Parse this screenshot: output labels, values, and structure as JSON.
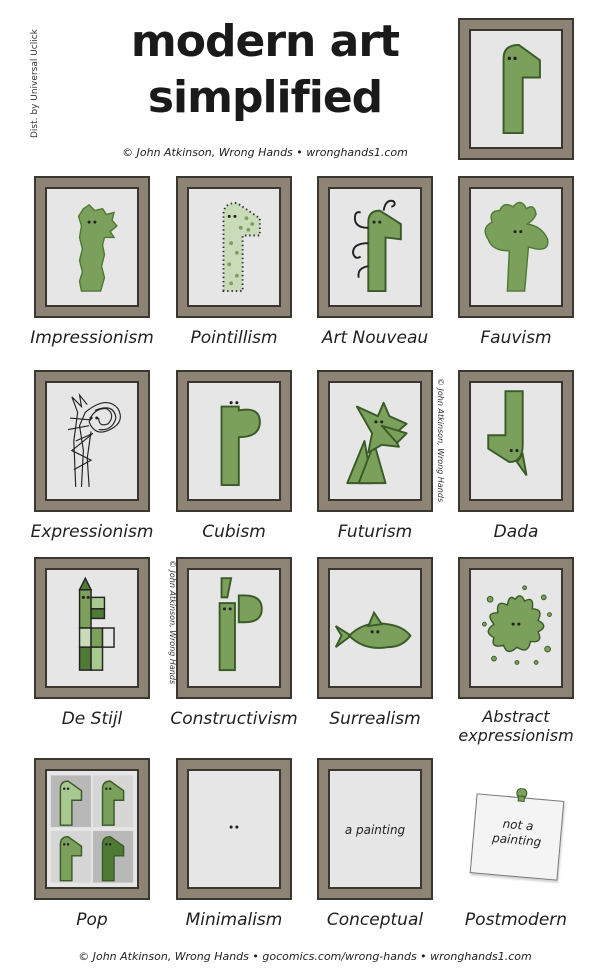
{
  "header": {
    "dist": "Dist. by Universal Uclick",
    "title_line1": "modern art",
    "title_line2": "simplified",
    "credit": "© John Atkinson, Wrong Hands • wronghands1.com"
  },
  "side_credits": {
    "upper": "© John Atkinson, Wrong Hands",
    "lower": "© John Atkinson, Wrong Hands"
  },
  "paintings": [
    {
      "id": "impressionism",
      "label": "Impressionism"
    },
    {
      "id": "pointillism",
      "label": "Pointillism"
    },
    {
      "id": "art-nouveau",
      "label": "Art Nouveau"
    },
    {
      "id": "fauvism",
      "label": "Fauvism"
    },
    {
      "id": "expressionism",
      "label": "Expressionism"
    },
    {
      "id": "cubism",
      "label": "Cubism"
    },
    {
      "id": "futurism",
      "label": "Futurism"
    },
    {
      "id": "dada",
      "label": "Dada"
    },
    {
      "id": "de-stijl",
      "label": "De Stijl"
    },
    {
      "id": "constructivism",
      "label": "Constructivism"
    },
    {
      "id": "surrealism",
      "label": "Surrealism"
    },
    {
      "id": "abstract-expressionism",
      "label_line1": "Abstract",
      "label_line2": "expressionism"
    },
    {
      "id": "pop",
      "label": "Pop"
    },
    {
      "id": "minimalism",
      "label": "Minimalism"
    },
    {
      "id": "conceptual",
      "label": "Conceptual",
      "canvas_text": "a painting"
    },
    {
      "id": "postmodern",
      "label": "Postmodern",
      "note_line1": "not a",
      "note_line2": "painting"
    }
  ],
  "footer": {
    "credit": "© John Atkinson, Wrong Hands • gocomics.com/wrong-hands • wronghands1.com"
  },
  "colors": {
    "giraffe_green": "#7ba05b",
    "giraffe_dark": "#4f7a35",
    "canvas": "#e6e6e6",
    "frame": "#8d8475"
  }
}
